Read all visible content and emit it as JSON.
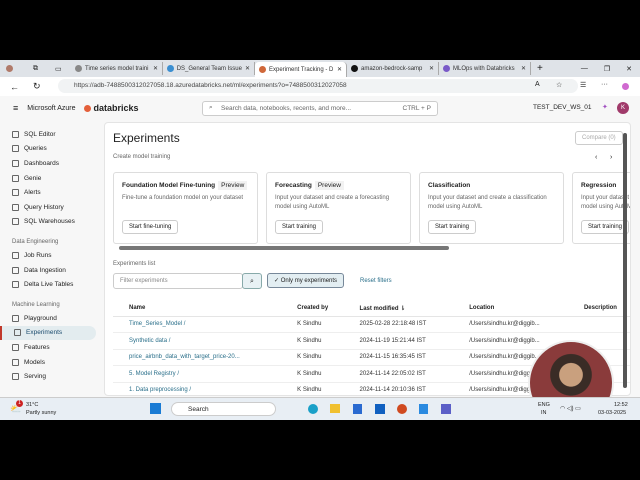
{
  "browser": {
    "tabs": [
      {
        "label": "Time series model traini"
      },
      {
        "label": "DS_General Team Issue"
      },
      {
        "label": "Experiment Tracking - D",
        "active": true
      },
      {
        "label": "amazon-bedrock-samp"
      },
      {
        "label": "MLOps with Databricks"
      }
    ],
    "url": "https://adb-7488500312027058.18.azuredatabricks.net/ml/experiments?o=7488500312027058"
  },
  "header": {
    "brand_ms": "Microsoft Azure",
    "brand": "databricks",
    "search_placeholder": "Search data, notebooks, recents, and more...",
    "shortcut": "CTRL + P",
    "workspace": "TEST_DEV_WS_01",
    "avatar": "K"
  },
  "sidebar": {
    "items": [
      {
        "label": "SQL Editor"
      },
      {
        "label": "Queries"
      },
      {
        "label": "Dashboards"
      },
      {
        "label": "Genie"
      },
      {
        "label": "Alerts"
      },
      {
        "label": "Query History"
      },
      {
        "label": "SQL Warehouses"
      }
    ],
    "section_de": "Data Engineering",
    "de_items": [
      {
        "label": "Job Runs"
      },
      {
        "label": "Data Ingestion"
      },
      {
        "label": "Delta Live Tables"
      }
    ],
    "section_ml": "Machine Learning",
    "ml_items": [
      {
        "label": "Playground"
      },
      {
        "label": "Experiments",
        "active": true
      },
      {
        "label": "Features"
      },
      {
        "label": "Models"
      },
      {
        "label": "Serving"
      }
    ]
  },
  "main": {
    "title": "Experiments",
    "compare": "Compare (0)",
    "create_label": "Create model training",
    "cards": [
      {
        "title": "Foundation Model Fine-tuning",
        "badge": "Preview",
        "desc": "Fine-tune a foundation model on your dataset",
        "button": "Start fine-tuning"
      },
      {
        "title": "Forecasting",
        "badge": "Preview",
        "desc": "Input your dataset and create a forecasting model using AutoML",
        "button": "Start training"
      },
      {
        "title": "Classification",
        "badge": "",
        "desc": "Input your dataset and create a classification model using AutoML",
        "button": "Start training"
      },
      {
        "title": "Regression",
        "badge": "",
        "desc": "Input your dataset and create a regression model using AutoML",
        "button": "Start training"
      }
    ],
    "list_label": "Experiments list",
    "filter_placeholder": "Filter experiments",
    "only_mine": "✓ Only my experiments",
    "reset": "Reset filters",
    "columns": [
      "Name",
      "Created by",
      "Last modified ⇂",
      "Location",
      "Description"
    ],
    "rows": [
      [
        "Time_Series_Model  /",
        "K Sindhu",
        "2025-02-28 22:18:48 IST",
        "/Users/sindhu.kr@diggib..."
      ],
      [
        "Synthetic data  /",
        "K Sindhu",
        "2024-11-19 15:21:44 IST",
        "/Users/sindhu.kr@diggib..."
      ],
      [
        "price_airbnb_data_with_target_price-20...",
        "K Sindhu",
        "2024-11-15 16:35:45 IST",
        "/Users/sindhu.kr@diggib..."
      ],
      [
        "5. Model Registry  /",
        "K Sindhu",
        "2024-11-14 22:05:02 IST",
        "/Users/sindhu.kr@diggib..."
      ],
      [
        "1. Data preprocessing  /",
        "K Sindhu",
        "2024-11-14 20:10:36 IST",
        "/Users/sindhu.kr@diggib..."
      ]
    ]
  },
  "taskbar": {
    "temp": "31°C",
    "weather": "Partly sunny",
    "weather_badge": "1",
    "search": "Search",
    "lang1": "ENG",
    "lang2": "IN",
    "time": "12:52",
    "date": "03-03-2025"
  }
}
